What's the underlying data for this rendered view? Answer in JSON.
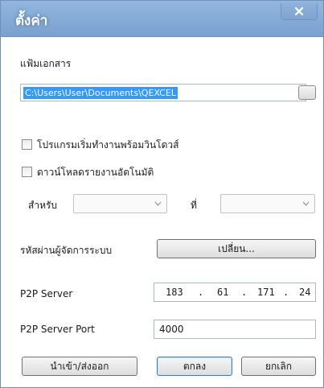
{
  "window": {
    "title": "ตั้งค่า",
    "close_symbol": "✕"
  },
  "document_folder": {
    "label": "แฟ้มเอกสาร",
    "path": "C:\\Users\\User\\Documents\\QEXCEL"
  },
  "startup": {
    "label": "โปรแกรมเริ่มทำงานพร้อมวินโดวส์",
    "checked": false
  },
  "auto_download": {
    "label": "ดาวน์โหลดรายงานอัตโนมัติ",
    "checked": false
  },
  "schedule": {
    "for_label": "สำหรับ",
    "at_label": "ที่",
    "for_value": "",
    "at_value": ""
  },
  "admin_password": {
    "label": "รหัสผ่านผู้จัดการระบบ",
    "button": "เปลี่ยน..."
  },
  "p2p_server": {
    "label": "P2P Server",
    "octets": [
      "183",
      "61",
      "171",
      "24"
    ],
    "separator": "."
  },
  "p2p_port": {
    "label": "P2P Server Port",
    "value": "4000"
  },
  "buttons": {
    "import_export": "นำเข้า/ส่งออก",
    "ok": "ตกลง",
    "cancel": "ยกเลิก"
  }
}
